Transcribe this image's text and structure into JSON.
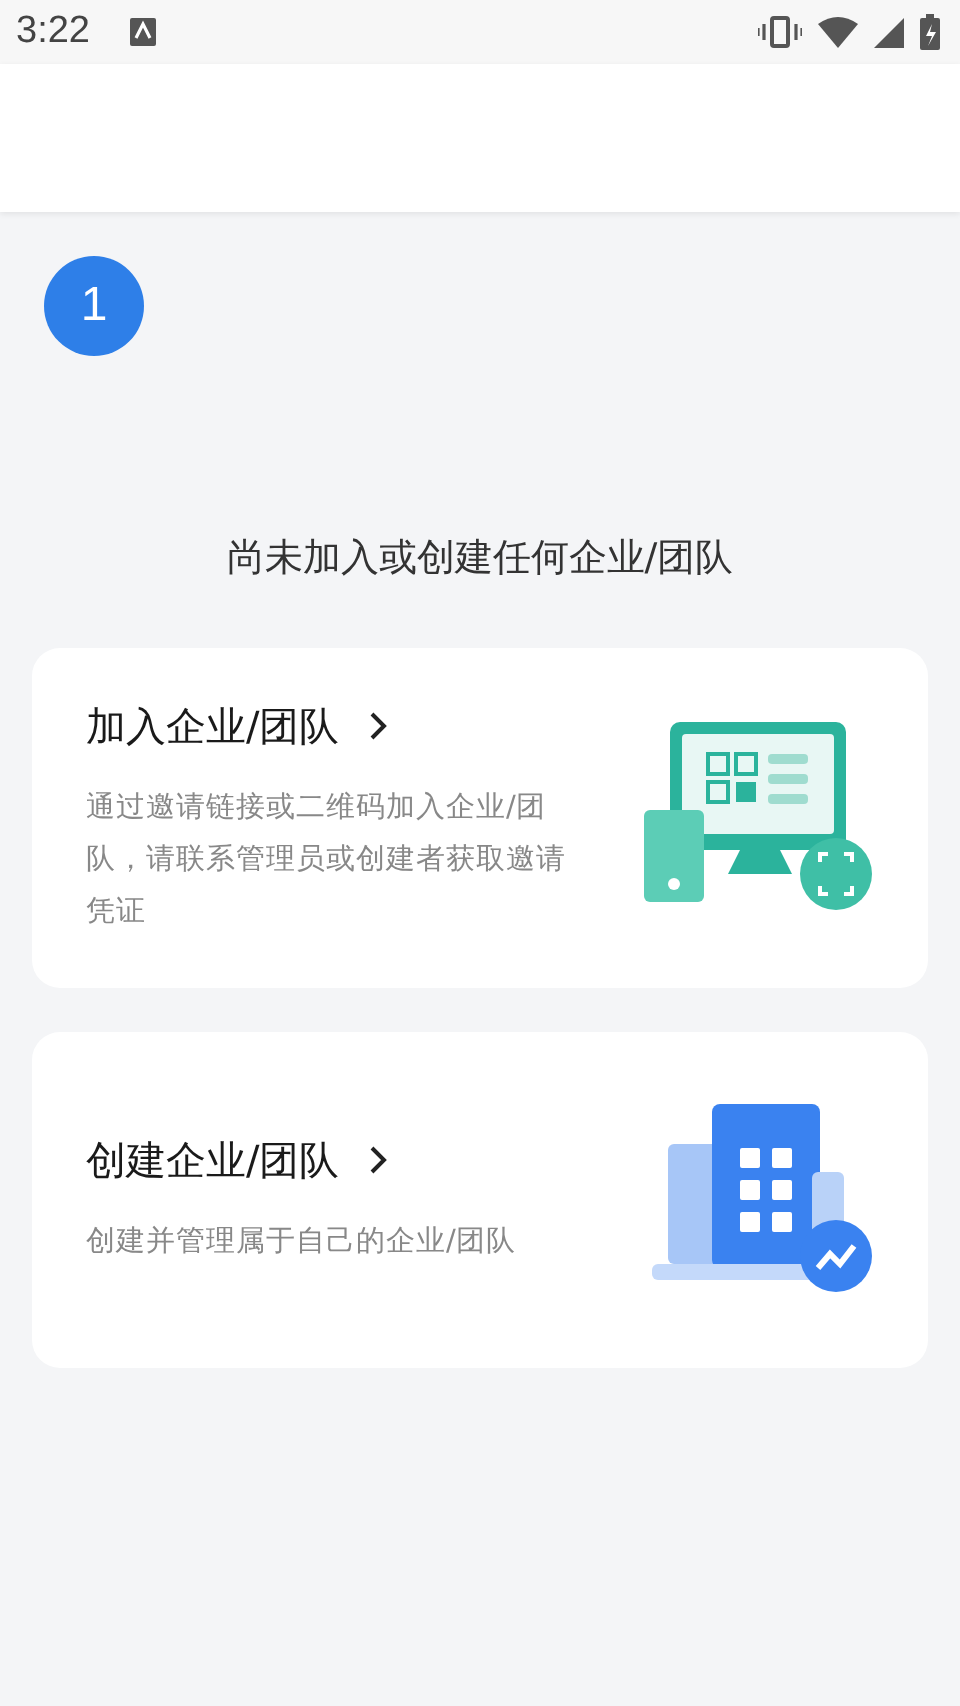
{
  "status_bar": {
    "time": "3:22"
  },
  "step_badge": "1",
  "empty_message": "尚未加入或创建任何企业/团队",
  "cards": [
    {
      "kind": "join",
      "title": "加入企业/团队",
      "description": "通过邀请链接或二维码加入企业/团队，请联系管理员或创建者获取邀请凭证"
    },
    {
      "kind": "create",
      "title": "创建企业/团队",
      "description": "创建并管理属于自己的企业/团队"
    }
  ]
}
